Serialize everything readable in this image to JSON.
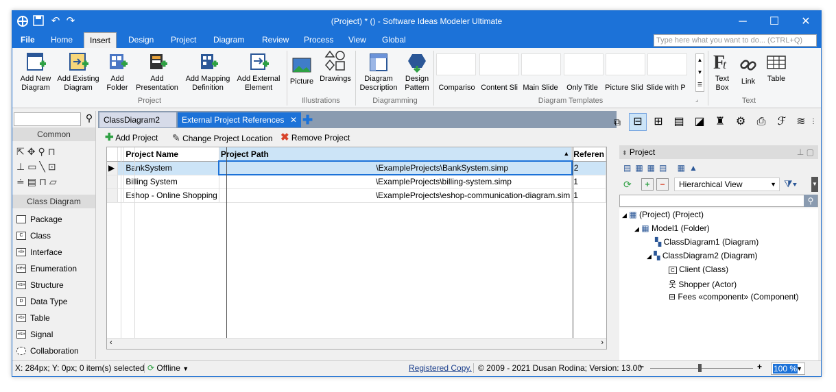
{
  "window": {
    "title": "(Project) * () - Software Ideas Modeler Ultimate"
  },
  "menu": {
    "tabs": [
      "File",
      "Home",
      "Insert",
      "Design",
      "Project",
      "Diagram",
      "Review",
      "Process",
      "View",
      "Global"
    ],
    "active": "Insert",
    "search_placeholder": "Type here what you want to do...  (CTRL+Q)"
  },
  "ribbon": {
    "project_group": {
      "label": "Project",
      "buttons": [
        "Add New Diagram",
        "Add Existing Diagram",
        "Add Folder",
        "Add Presentation",
        "Add Mapping Definition",
        "Add External Element"
      ]
    },
    "illustrations_group": {
      "label": "Illustrations",
      "buttons": [
        "Picture",
        "Drawings"
      ]
    },
    "diagramming_group": {
      "label": "Diagramming",
      "buttons": [
        "Diagram Description",
        "Design Pattern"
      ]
    },
    "templates_group": {
      "label": "Diagram Templates",
      "items": [
        "Compariso",
        "Content Sli",
        "Main Slide",
        "Only Title",
        "Picture Slid",
        "Slide with P"
      ]
    },
    "text_group": {
      "label": "Text",
      "buttons": [
        "Text Box",
        "Link",
        "Table"
      ]
    }
  },
  "left_panel": {
    "search_value": "",
    "common_header": "Common",
    "class_diagram_header": "Class Diagram",
    "tools": [
      "Package",
      "Class",
      "Interface",
      "Enumeration",
      "Structure",
      "Data Type",
      "Table",
      "Signal",
      "Collaboration"
    ],
    "tool_icons": [
      "",
      "C",
      "«i»",
      "«e»",
      "«s»",
      "D",
      "«t»",
      "«s»",
      ""
    ]
  },
  "document": {
    "tabs": [
      "ClassDiagram2",
      "External Project References"
    ],
    "active_tab": "External Project References",
    "toolbar": {
      "add": "Add Project",
      "change": "Change Project Location",
      "remove": "Remove Project"
    },
    "grid": {
      "columns": [
        "Project Name",
        "Project Path",
        "Referen"
      ],
      "rows": [
        {
          "name": "BankSystem",
          "path": "\\ExampleProjects\\BankSystem.simp",
          "ref": "2"
        },
        {
          "name": "Billing System",
          "path": "\\ExampleProjects\\billing-system.simp",
          "ref": "1"
        },
        {
          "name": "Eshop - Online Shopping",
          "path": "\\ExampleProjects\\eshop-communication-diagram.sim",
          "ref": "1"
        }
      ]
    }
  },
  "project_panel": {
    "title": "Project",
    "view_select": "Hierarchical View",
    "tree": [
      {
        "label": "(Project) (Project)",
        "level": 0
      },
      {
        "label": "Model1 (Folder)",
        "level": 1
      },
      {
        "label": "ClassDiagram1 (Diagram)",
        "level": 2
      },
      {
        "label": "ClassDiagram2 (Diagram)",
        "level": 2
      },
      {
        "label": "Client (Class)",
        "level": 3
      },
      {
        "label": "Shopper (Actor)",
        "level": 3
      },
      {
        "label": "Fees «component» (Component)",
        "level": 3
      }
    ]
  },
  "status": {
    "position": "X: 284px; Y: 0px; 0 item(s) selected",
    "connection": "Offline",
    "registered": "Registered Copy.",
    "copyright": "© 2009 - 2021 Dusan Rodina; Version: 13.00",
    "zoom": "100 %"
  },
  "colors": {
    "titlebar": "#1c72d8",
    "selection": "#cce4f7",
    "active_tab": "#1c72d8"
  }
}
